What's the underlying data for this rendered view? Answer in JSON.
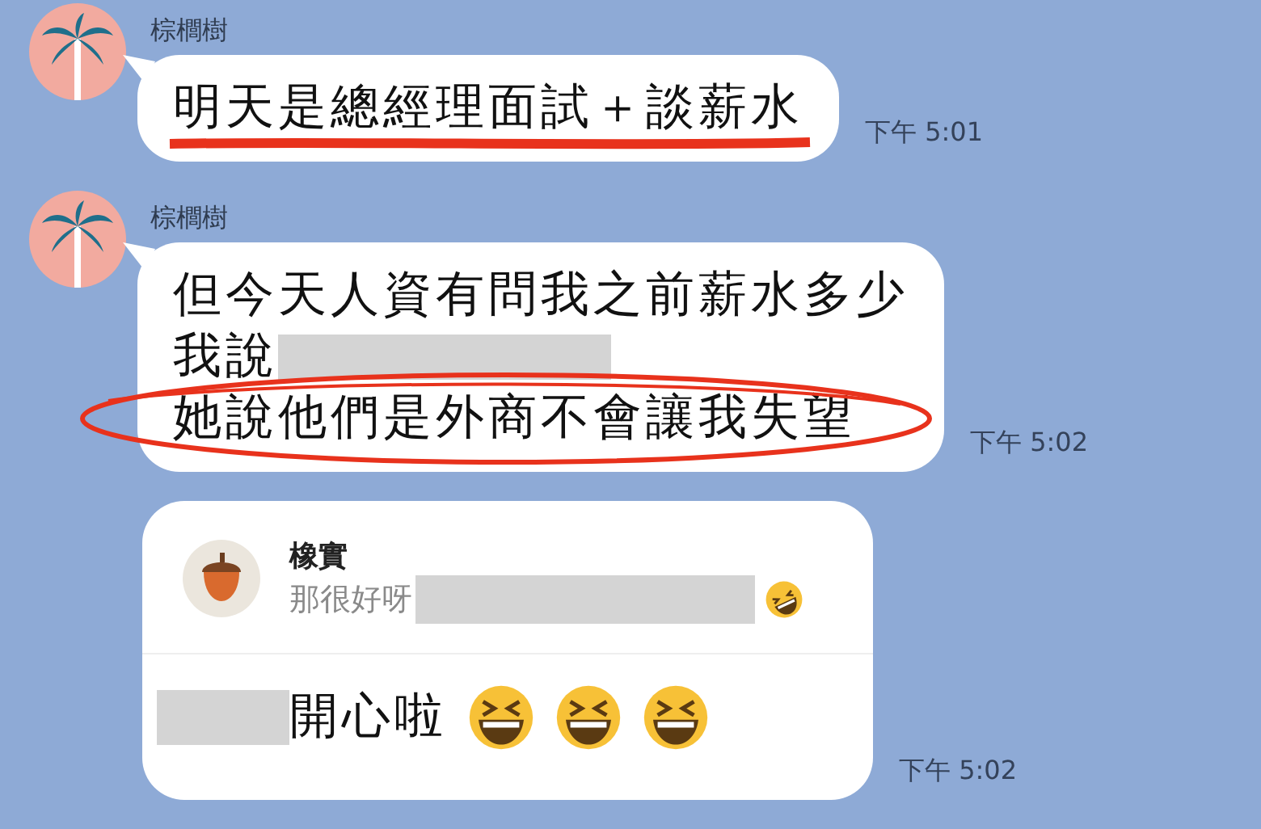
{
  "messages": [
    {
      "sender": "棕櫚樹",
      "avatar": {
        "kind": "palm"
      },
      "time": "下午 5:01",
      "lines": [
        {
          "annotation": {
            "kind": "underline"
          },
          "segments": [
            {
              "kind": "text",
              "text": "明天是總經理面試＋談薪水"
            }
          ]
        }
      ]
    },
    {
      "sender": "棕櫚樹",
      "avatar": {
        "kind": "palm"
      },
      "time": "下午 5:02",
      "lines": [
        {
          "segments": [
            {
              "kind": "text",
              "text": "但今天人資有問我之前薪水多少"
            }
          ]
        },
        {
          "segments": [
            {
              "kind": "text",
              "text": "我說"
            },
            {
              "kind": "redacted"
            }
          ]
        },
        {
          "annotation": {
            "kind": "ellipse"
          },
          "segments": [
            {
              "kind": "text",
              "text": "她說他們是外商不會讓我失望"
            }
          ]
        }
      ]
    },
    {
      "time": "下午 5:02",
      "reply": {
        "sender": "橡實",
        "avatar": {
          "kind": "acorn"
        },
        "segments": [
          {
            "kind": "text",
            "text": "那很好呀"
          },
          {
            "kind": "redacted"
          },
          {
            "kind": "rofl"
          }
        ]
      },
      "lines": [
        {
          "segments": [
            {
              "kind": "redacted"
            },
            {
              "kind": "text",
              "text": "開心啦"
            },
            {
              "kind": "grin"
            },
            {
              "kind": "grin"
            },
            {
              "kind": "grin"
            }
          ]
        }
      ]
    }
  ]
}
